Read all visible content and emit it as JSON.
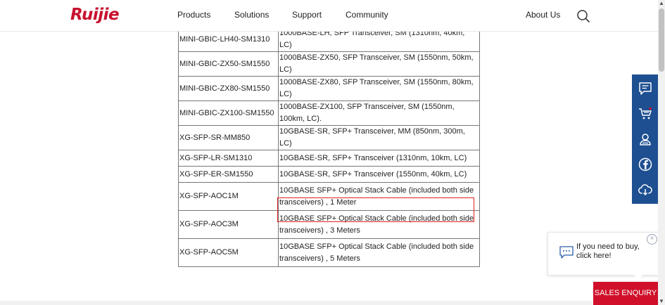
{
  "header": {
    "logo_text": "Ruijie",
    "nav": [
      "Products",
      "Solutions",
      "Support",
      "Community"
    ],
    "about": "About Us"
  },
  "table": {
    "rows": [
      {
        "model": "MINI-GBIC-LH40-SM1310",
        "desc": "1000BASE-LH, SFP Transceiver, SM (1310nm, 40km, LC)"
      },
      {
        "model": "MINI-GBIC-ZX50-SM1550",
        "desc": "1000BASE-ZX50, SFP Transceiver, SM (1550nm, 50km, LC)"
      },
      {
        "model": "MINI-GBIC-ZX80-SM1550",
        "desc": "1000BASE-ZX80, SFP Transceiver, SM (1550nm, 80km, LC)"
      },
      {
        "model": "MINI-GBIC-ZX100-SM1550",
        "desc": "1000BASE-ZX100, SFP Transceiver, SM (1550nm, 100km, LC)."
      },
      {
        "model": "XG-SFP-SR-MM850",
        "desc": "10GBASE-SR, SFP+ Transceiver, MM (850nm, 300m, LC)"
      },
      {
        "model": "XG-SFP-LR-SM1310",
        "desc": "10GBASE-SR, SFP+ Transceiver (1310nm, 10km, LC)"
      },
      {
        "model": "XG-SFP-ER-SM1550",
        "desc": "10GBASE-SR, SFP+ Transceiver (1550nm, 40km, LC)"
      },
      {
        "model": "XG-SFP-AOC1M",
        "desc": "10GBASE SFP+ Optical Stack Cable (included both side transceivers) , 1 Meter"
      },
      {
        "model": "XG-SFP-AOC3M",
        "desc": "10GBASE SFP+ Optical Stack Cable (included both side transceivers) , 3 Meters"
      },
      {
        "model": "XG-SFP-AOC5M",
        "desc": "10GBASE SFP+ Optical Stack Cable (included both side transceivers) , 5 Meters"
      }
    ]
  },
  "toolbar": {
    "icons": [
      "message-icon",
      "cart-icon",
      "contact-icon",
      "facebook-icon",
      "download-icon"
    ]
  },
  "chat": {
    "text": "If you need to buy, click here!",
    "close": "×"
  },
  "sales_enquiry": "SALES ENQUIRY",
  "colors": {
    "brand": "#c8102e",
    "toolbar": "#1d4f91",
    "sales": "#d0102a",
    "highlight": "#e02020"
  }
}
